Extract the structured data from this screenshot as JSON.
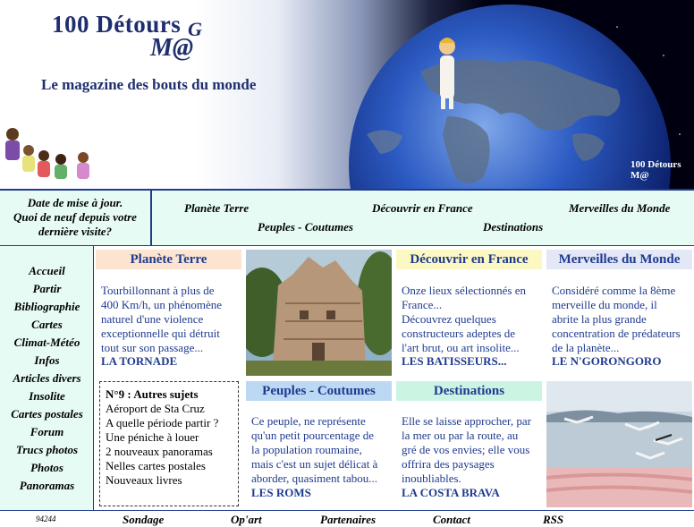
{
  "header": {
    "brand_title": "100 Détours",
    "brand_mac": "M@",
    "brand_g": "G",
    "tagline": "Le magazine des bouts du monde",
    "globe_caption": "100 Détours",
    "globe_caption_mac": "M@"
  },
  "topnav": {
    "update_line1": "Date de mise à jour.",
    "update_line2": "Quoi de neuf depuis votre",
    "update_line3": "dernière visite?",
    "links": [
      "Planète Terre",
      "Découvrir en France",
      "Merveilles du Monde",
      "Peuples - Coutumes",
      "Destinations"
    ]
  },
  "sidebar": {
    "items": [
      "Accueil",
      "Partir",
      "Bibliographie",
      "Cartes",
      "Climat-Météo",
      "Infos",
      "Articles divers",
      "Insolite",
      "Cartes postales",
      "Forum",
      "Trucs photos",
      "Photos",
      "Panoramas"
    ]
  },
  "sections": {
    "planete": {
      "title": "Planète Terre",
      "text": [
        "Tourbillonnant à plus de",
        "400 Km/h, un phénomène",
        "naturel d'une violence",
        "exceptionnelle qui détruit",
        "tout sur son passage..."
      ],
      "link": "LA TORNADE",
      "color": "#fde4d0"
    },
    "france": {
      "title": "Découvrir en France",
      "text": [
        "Onze lieux sélectionnés en",
        "France...",
        "Découvrez quelques",
        "constructeurs adeptes de",
        "l'art brut, ou art insolite..."
      ],
      "link": "LES BATISSEURS...",
      "color": "#fcf8c2"
    },
    "merveilles": {
      "title": "Merveilles du Monde",
      "text": [
        "Considéré comme la 8ème",
        "merveille du monde, il",
        "abrite la plus grande",
        "concentration de prédateurs",
        "de la planète..."
      ],
      "link": "LE N'GORONGORO",
      "color": "#e3e7f6"
    },
    "peuples": {
      "title": "Peuples - Coutumes",
      "text": [
        "Ce peuple, ne représente",
        "qu'un petit pourcentage de",
        "la population roumaine,",
        "mais c'est un sujet délicat à",
        "aborder, quasiment tabou..."
      ],
      "link": "LES ROMS",
      "color": "#bcd8f2"
    },
    "destinations": {
      "title": "Destinations",
      "text": [
        "Elle se laisse approcher, par",
        "la mer ou par la route, au",
        "gré de vos envies; elle vous",
        "offrira des paysages",
        "inoubliables."
      ],
      "link": "LA COSTA BRAVA",
      "color": "#ccf4e3"
    }
  },
  "autres": {
    "title": "N°9 : Autres sujets",
    "items": [
      "Aéroport de Sta Cruz",
      "A quelle période partir ?",
      "Une péniche à louer",
      "2 nouveaux panoramas",
      "Nelles cartes postales",
      "Nouveaux livres"
    ]
  },
  "footer": {
    "counter": "94244",
    "links": [
      "Sondage",
      "Op'art",
      "Partenaires",
      "Contact",
      "RSS"
    ]
  }
}
